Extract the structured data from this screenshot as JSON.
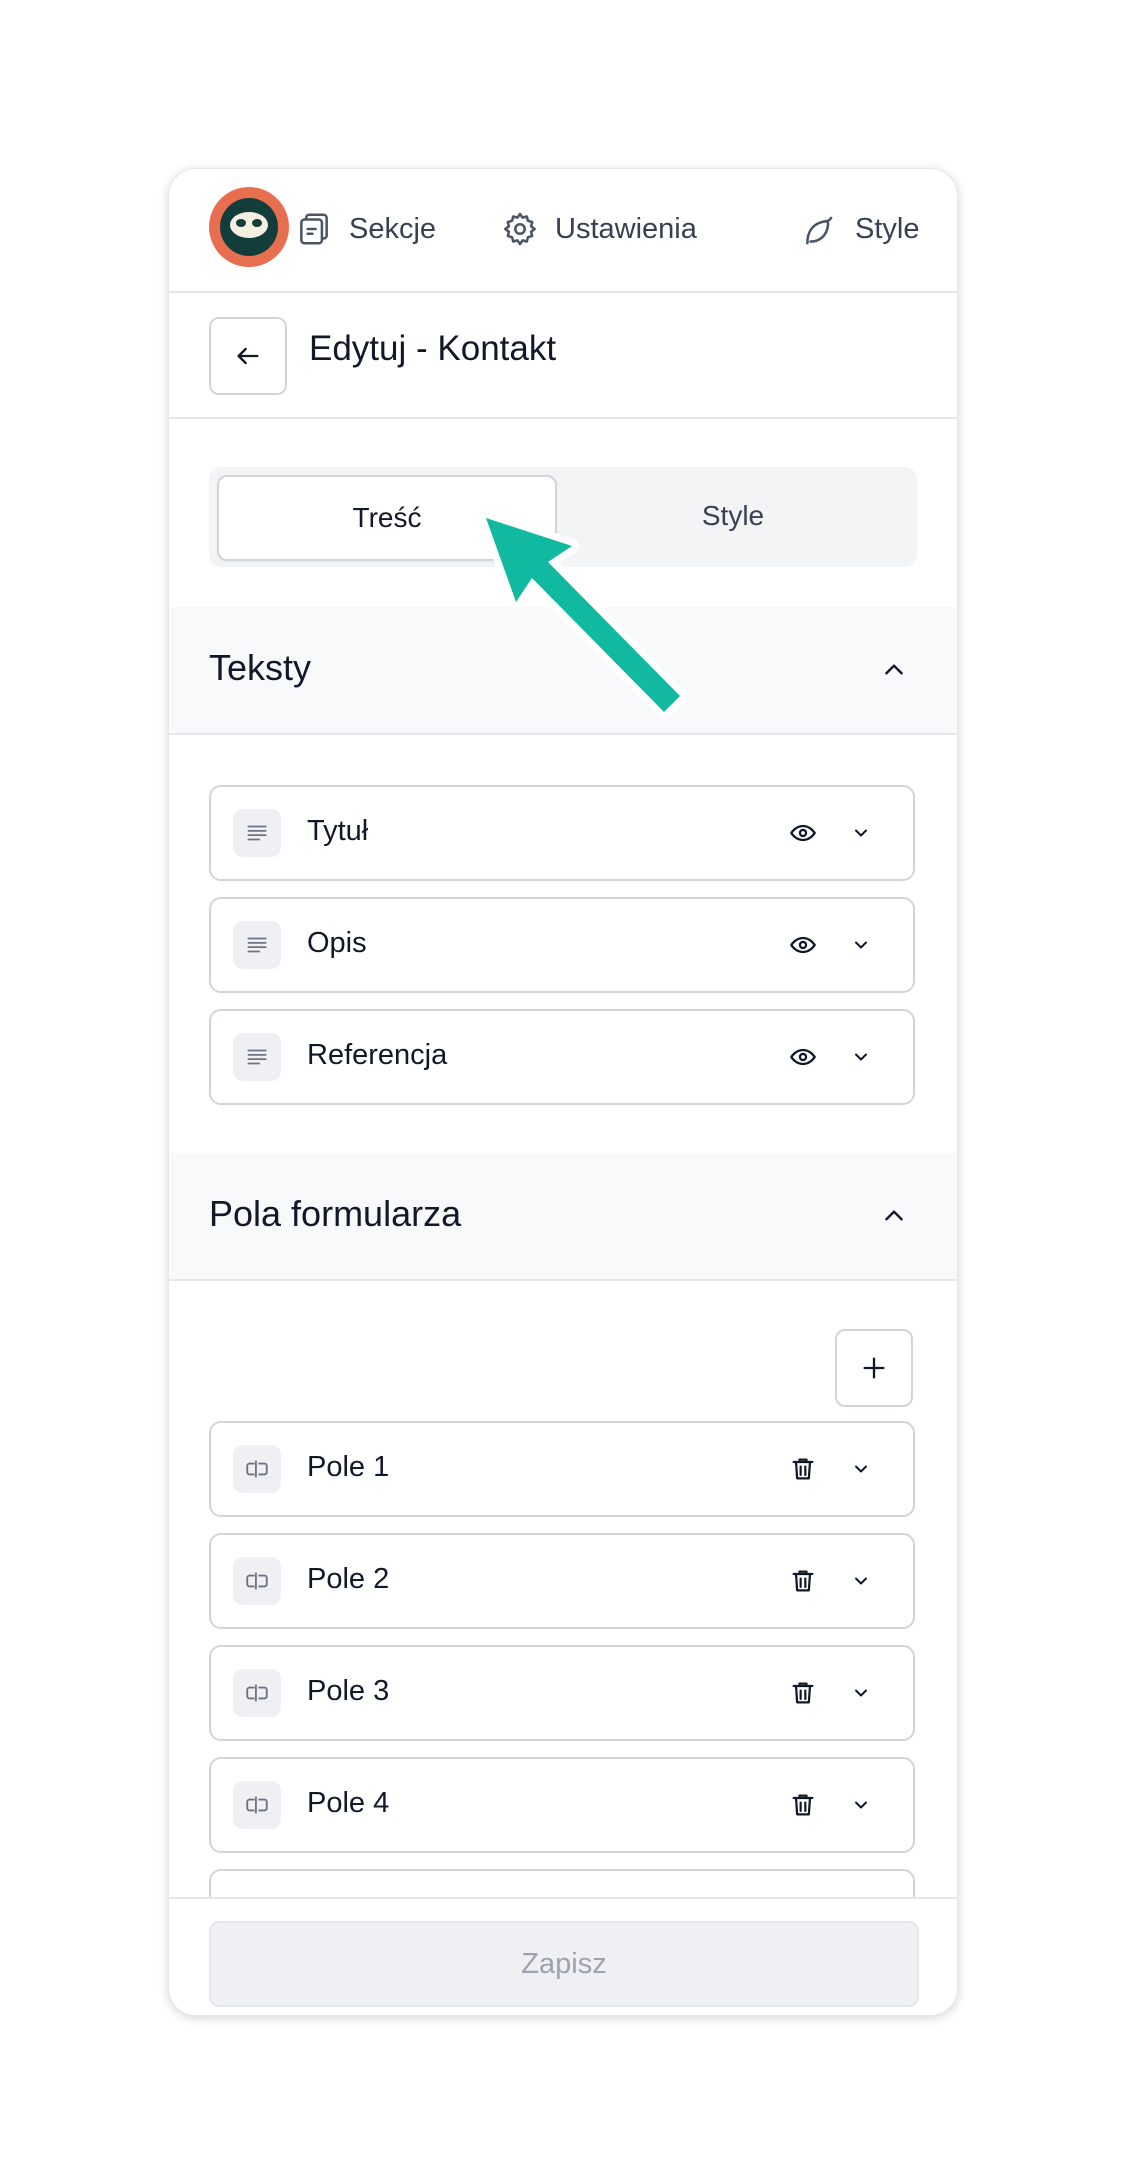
{
  "topnav": {
    "items": [
      {
        "label": "Sekcje",
        "icon": "copy-icon"
      },
      {
        "label": "Ustawienia",
        "icon": "gear-icon"
      },
      {
        "label": "Style",
        "icon": "leaf-icon"
      }
    ]
  },
  "header": {
    "title": "Edytuj - Kontakt"
  },
  "tabs": [
    {
      "label": "Treść",
      "active": true
    },
    {
      "label": "Style",
      "active": false
    }
  ],
  "sections": {
    "teksty": {
      "title": "Teksty",
      "items": [
        {
          "label": "Tytuł"
        },
        {
          "label": "Opis"
        },
        {
          "label": "Referencja"
        }
      ]
    },
    "pola": {
      "title": "Pola formularza",
      "items": [
        {
          "label": "Pole 1"
        },
        {
          "label": "Pole 2"
        },
        {
          "label": "Pole 3"
        },
        {
          "label": "Pole 4"
        }
      ]
    }
  },
  "footer": {
    "save_label": "Zapisz"
  },
  "colors": {
    "accent_arrow": "#10b9a0",
    "logo_ring": "#e76f4f",
    "logo_bg": "#123d3a"
  }
}
